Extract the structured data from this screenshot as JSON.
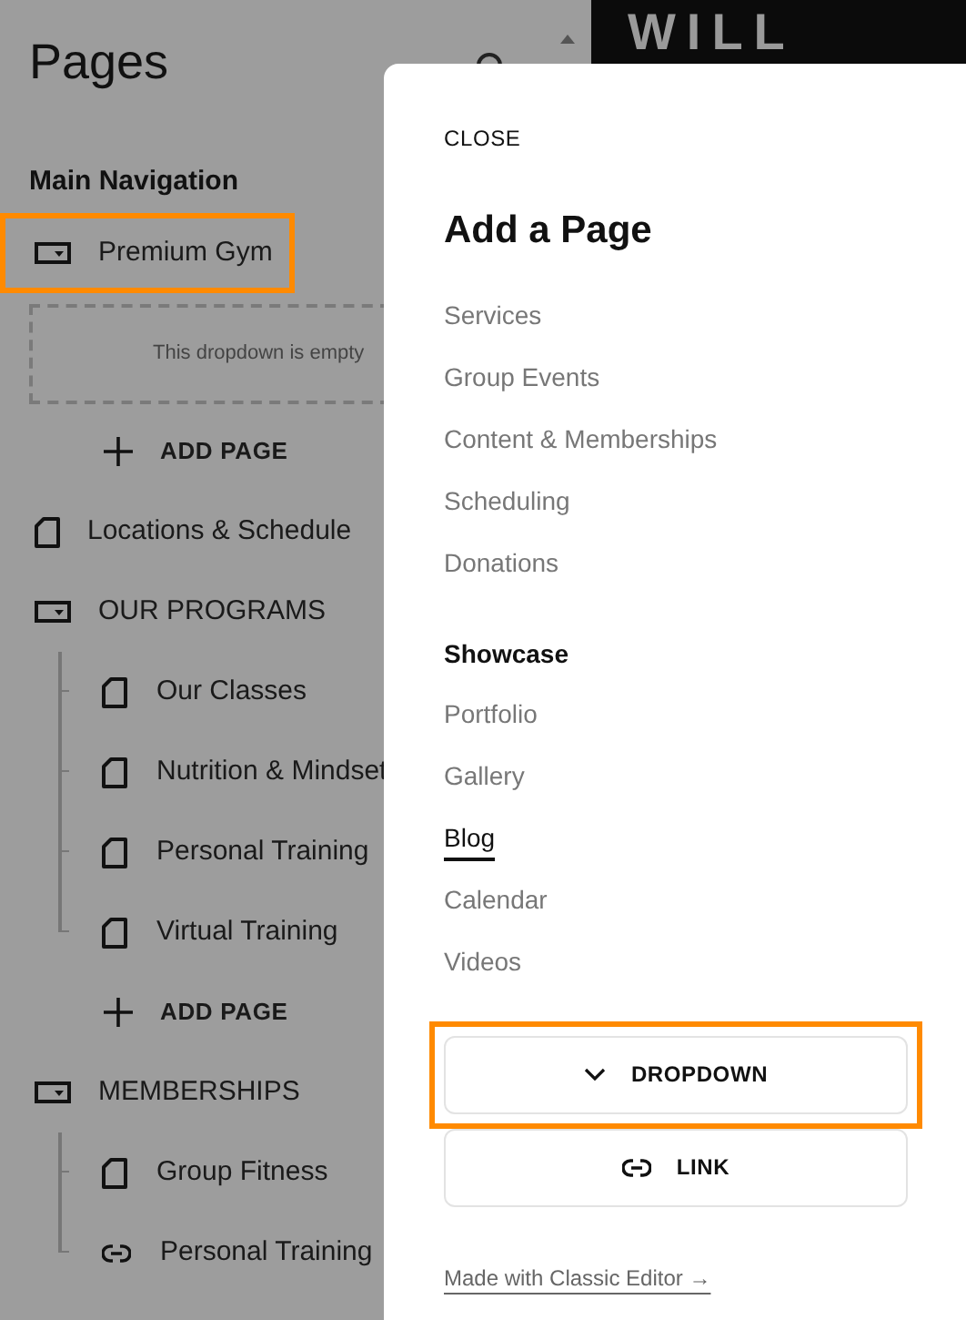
{
  "sidebar": {
    "title": "Pages",
    "section": "Main Navigation",
    "items": [
      {
        "kind": "dropdown",
        "label": "Premium Gym",
        "highlighted": true,
        "empty_text": "This dropdown is empty",
        "add_label": "ADD PAGE"
      },
      {
        "kind": "page",
        "label": "Locations & Schedule",
        "highlighted": false
      },
      {
        "kind": "dropdown",
        "label": "OUR PROGRAMS",
        "highlighted": false,
        "add_label": "ADD PAGE",
        "children": [
          {
            "kind": "page",
            "label": "Our Classes"
          },
          {
            "kind": "page",
            "label": "Nutrition & Mindset"
          },
          {
            "kind": "page",
            "label": "Personal Training"
          },
          {
            "kind": "page",
            "label": "Virtual Training"
          }
        ]
      },
      {
        "kind": "dropdown",
        "label": "MEMBERSHIPS",
        "highlighted": false,
        "children": [
          {
            "kind": "page",
            "label": "Group Fitness"
          },
          {
            "kind": "link",
            "label": "Personal Training"
          }
        ]
      }
    ]
  },
  "preview": {
    "hero_text": "WILL"
  },
  "dialog": {
    "close": "CLOSE",
    "title": "Add a Page",
    "pages": [
      {
        "label": "Services",
        "selected": false
      },
      {
        "label": "Group Events",
        "selected": false
      },
      {
        "label": "Content & Memberships",
        "selected": false
      },
      {
        "label": "Scheduling",
        "selected": false
      },
      {
        "label": "Donations",
        "selected": false
      }
    ],
    "showcase_title": "Showcase",
    "showcase": [
      {
        "label": "Portfolio",
        "selected": false
      },
      {
        "label": "Gallery",
        "selected": false
      },
      {
        "label": "Blog",
        "selected": true
      },
      {
        "label": "Calendar",
        "selected": false
      },
      {
        "label": "Videos",
        "selected": false
      }
    ],
    "buttons": [
      {
        "kind": "dropdown",
        "label": "DROPDOWN",
        "highlighted": true
      },
      {
        "kind": "link",
        "label": "LINK",
        "highlighted": false
      }
    ],
    "footer_link": "Made with Classic Editor →"
  }
}
